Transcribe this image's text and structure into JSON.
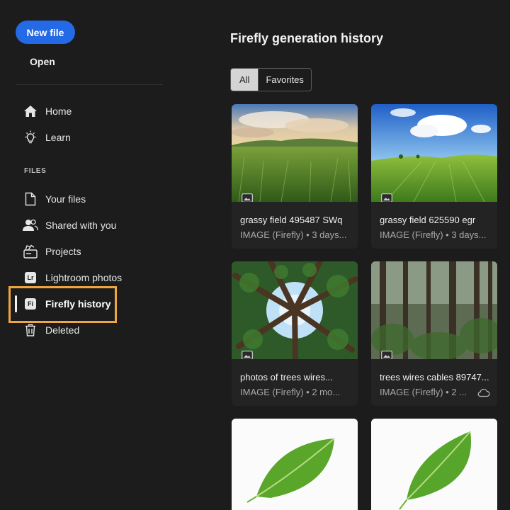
{
  "sidebar": {
    "new_file": "New file",
    "open": "Open",
    "section_files": "FILES",
    "items": [
      {
        "label": "Home",
        "icon": "home-icon"
      },
      {
        "label": "Learn",
        "icon": "lightbulb-icon"
      },
      {
        "label": "Your files",
        "icon": "file-icon"
      },
      {
        "label": "Shared with you",
        "icon": "people-icon"
      },
      {
        "label": "Projects",
        "icon": "projects-icon"
      },
      {
        "label": "Lightroom photos",
        "icon": "lightroom-icon",
        "badge": "Lr"
      },
      {
        "label": "Firefly history",
        "icon": "firefly-icon",
        "badge": "Fi",
        "active": true
      },
      {
        "label": "Deleted",
        "icon": "trash-icon"
      }
    ]
  },
  "main": {
    "title": "Firefly generation history",
    "filters": [
      "All",
      "Favorites"
    ],
    "selected_filter": "All",
    "cards": [
      {
        "name": "grassy field 495487 SWq",
        "meta": "IMAGE (Firefly) • 3 days..."
      },
      {
        "name": "grassy field 625590 egr",
        "meta": "IMAGE (Firefly) • 3 days..."
      },
      {
        "name": "photos of trees wires...",
        "meta": "IMAGE (Firefly) • 2 mo..."
      },
      {
        "name": "trees wires cables 89747...",
        "meta": "IMAGE (Firefly) • 2 ..."
      },
      {
        "name": "",
        "meta": ""
      },
      {
        "name": "",
        "meta": ""
      }
    ]
  },
  "colors": {
    "background": "#1c1c1c",
    "accent_blue": "#2469e5",
    "highlight_orange": "#f0a640"
  }
}
